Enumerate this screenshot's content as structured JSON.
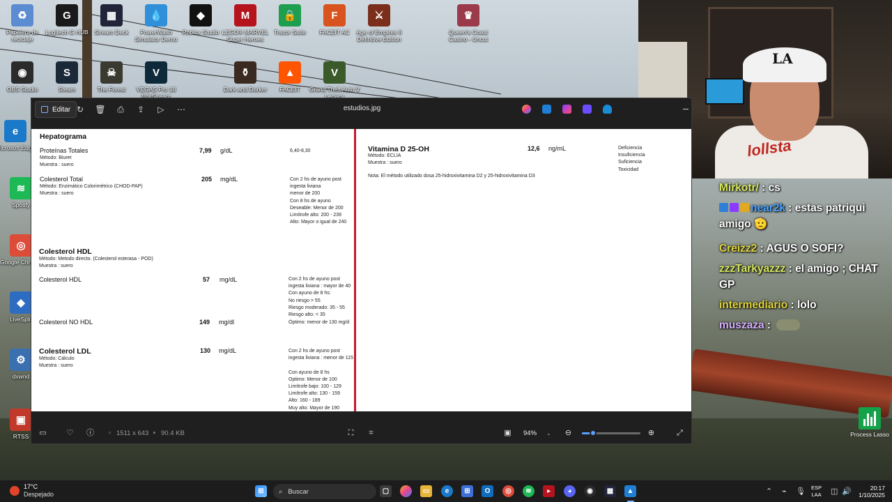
{
  "desktop": {
    "icons": [
      {
        "label": "Papelera de reciclaje",
        "icon": "recycle-bin-icon",
        "color": "#5b8bd1",
        "glyph": "♻"
      },
      {
        "label": "Logitech G HUB",
        "icon": "logitech-icon",
        "color": "#1a1a1a",
        "glyph": "G"
      },
      {
        "label": "Stream Deck",
        "icon": "stream-deck-icon",
        "color": "#22253a",
        "glyph": "▦"
      },
      {
        "label": "PowerWash Simulator Demo",
        "icon": "powerwash-icon",
        "color": "#2f8fd8",
        "glyph": "💧"
      },
      {
        "label": "Roblox Studio",
        "icon": "roblox-icon",
        "color": "#111111",
        "glyph": "◆"
      },
      {
        "label": "LEGO® MARVEL Super Heroes",
        "icon": "lego-marvel-icon",
        "color": "#b5141d",
        "glyph": "M"
      },
      {
        "label": "Trezor Suite",
        "icon": "trezor-icon",
        "color": "#1e9e4f",
        "glyph": "🔒"
      },
      {
        "label": "FACEIT AC",
        "icon": "faceit-ac-icon",
        "color": "#d9531e",
        "glyph": "F"
      },
      {
        "label": "Age of Empires II Definitive Edition",
        "icon": "aoe-icon",
        "color": "#7a2e1b",
        "glyph": "⚔"
      },
      {
        "label": "Queen's Coast Casino - Uncut",
        "icon": "casino-icon",
        "color": "#9a3a4a",
        "glyph": "♛"
      },
      {
        "label": "OBS Studio",
        "icon": "obs-icon",
        "color": "#2b2b2b",
        "glyph": "◉"
      },
      {
        "label": "Steam",
        "icon": "steam-icon",
        "color": "#1b2838",
        "glyph": "S"
      },
      {
        "label": "The Forest",
        "icon": "the-forest-icon",
        "color": "#3a3a30",
        "glyph": "☠"
      },
      {
        "label": "VEGAS Pro 18 EditStream",
        "icon": "vegas-icon",
        "color": "#0e2a3a",
        "glyph": "V"
      },
      {
        "label": "Dark and Darker",
        "icon": "dark-and-darker-icon",
        "color": "#3b2a1f",
        "glyph": "⚱"
      },
      {
        "label": "FACEIT",
        "icon": "faceit-icon",
        "color": "#ff5500",
        "glyph": "▲"
      },
      {
        "label": "Grand Theft Auto V Legacy",
        "icon": "gta-icon",
        "color": "#3a5a2a",
        "glyph": "V"
      },
      {
        "label": "Microsoft Edge",
        "icon": "edge-icon",
        "color": "#1b79c9",
        "glyph": "e"
      },
      {
        "label": "Spotify",
        "icon": "spotify-icon",
        "color": "#1db954",
        "glyph": "≋"
      },
      {
        "label": "Google Chrome",
        "icon": "chrome-icon",
        "color": "#dd4b39",
        "glyph": "◎"
      },
      {
        "label": "LiveSplit",
        "icon": "livesplit-icon",
        "color": "#2d6cc0",
        "glyph": "◆"
      },
      {
        "label": "dxwnd",
        "icon": "dxwnd-icon",
        "color": "#3a6fb0",
        "glyph": "⚙"
      },
      {
        "label": "RTSS",
        "icon": "rtss-icon",
        "color": "#c0392b",
        "glyph": "▣"
      }
    ],
    "process_lasso": {
      "label": "Process Lasso",
      "icon": "process-lasso-icon"
    }
  },
  "viewer": {
    "title": "estudios.jpg",
    "edit_label": "Editar",
    "toolbar_icons": [
      "rotate-icon",
      "delete-icon",
      "print-icon",
      "share-icon",
      "slideshow-icon",
      "more-icon"
    ],
    "app_icons": [
      "copilot-icon",
      "photos-editor-icon",
      "clipchamp-icon",
      "app-icon",
      "onedrive-icon"
    ],
    "status": {
      "dimensions": "1511 x 643",
      "size": "90.4 KB",
      "zoom": "94%",
      "zoom_level": 0.19
    }
  },
  "document": {
    "hepatograma": "Hepatograma",
    "proteinas": {
      "name": "Proteínas Totales",
      "metodo": "Método: Biuret",
      "muestra": "Muestra : suero",
      "value": "7,99",
      "unit": "g/dL",
      "ref": "6,40-8,30"
    },
    "colesterol_total": {
      "name": "Colesterol Total",
      "metodo": "Método: Enzimático Colorimétrico (CHOD-PAP)",
      "muestra": "Muestra : suero",
      "value": "205",
      "unit": "mg/dL",
      "ref": [
        "Con 2 hs de ayuno post",
        "ingesta liviana",
        "menor de 200",
        "Con 8 hs de ayuno",
        "Deseable: Menor de 200",
        "Limítrofe alto: 200 - 239",
        "Alto: Mayor o igual de 240"
      ]
    },
    "hdl_header": {
      "name": "Colesterol HDL",
      "metodo": "Método: Metodo  directo. (Colesterol esterasa - POD)",
      "muestra": "Muestra : suero"
    },
    "hdl": {
      "name": "Colesterol HDL",
      "value": "57",
      "unit": "mg/dL",
      "ref": [
        "Con 2 hs de ayuno post",
        " ingesta liviana : mayor de 40",
        "Con ayuno de 8 hs:",
        "No riesgo > 55",
        "Riesgo moderado: 35 - 55",
        "Riesgo alto: < 35"
      ]
    },
    "no_hdl": {
      "name": "Colesterol NO HDL",
      "value": "149",
      "unit": "mg/dl",
      "ref": "Óptimo: menor de 130 mg/d"
    },
    "ldl": {
      "name": "Colesterol LDL",
      "metodo": "Método: Cálculo",
      "muestra": "Muestra : suero",
      "value": "130",
      "unit": "mg/dL",
      "ref": [
        "Con 2 hs de ayuno post",
        " ingesta liviana : menor de 115",
        "",
        "Con ayuno de 8 hs",
        "Optimo: Menor de 100",
        "Limítrofe bajo: 100 - 129",
        "Limítrofe alto: 130 - 159",
        "Alto: 160 - 189",
        "Muy alto: Mayor de 190"
      ]
    },
    "vitamina_d": {
      "name": "Vitamina D 25-OH",
      "metodo": "Método: ECLIA",
      "muestra": "Muestra : suero",
      "value": "12,6",
      "unit": "ng/mL",
      "nota": "Nota: El método utilizado dosa 25-hidroxivitamina D2 y 25-hidroxivitamina D3",
      "ref": [
        "Deficiencia",
        "Insuficiencia",
        "Suficiencia",
        "Toxicidad"
      ]
    }
  },
  "webcam": {
    "cap_logo": "LA",
    "shirt_text": "lollsta"
  },
  "chat": [
    {
      "user": "Mirkotr/",
      "sep": " : ",
      "text": "cs",
      "color": "#d7e85a"
    },
    {
      "user": "near2k",
      "sep": " : ",
      "text": "estas patriqui amigo 🫡",
      "color": "#4aa3ff",
      "badges": true
    },
    {
      "user": "Creizz2",
      "sep": " : ",
      "text": "AGUS O SOFI?",
      "color": "#e0d43a"
    },
    {
      "user": "zzzTarkyazzz",
      "sep": " : ",
      "text": "el amigo ; CHAT GP",
      "color": "#d7e85a"
    },
    {
      "user": "intermediario",
      "sep": " : ",
      "text": "lolo",
      "color": "#e0d43a"
    },
    {
      "user": "muszaza",
      "sep": " : ",
      "text": "",
      "color": "#d7b0ff"
    }
  ],
  "taskbar": {
    "weather_temp": "17°C",
    "weather_desc": "Despejado",
    "search_placeholder": "Buscar",
    "lang_line1": "ESP",
    "lang_line2": "LAA",
    "time": "20:17",
    "date": "1/10/2025"
  }
}
